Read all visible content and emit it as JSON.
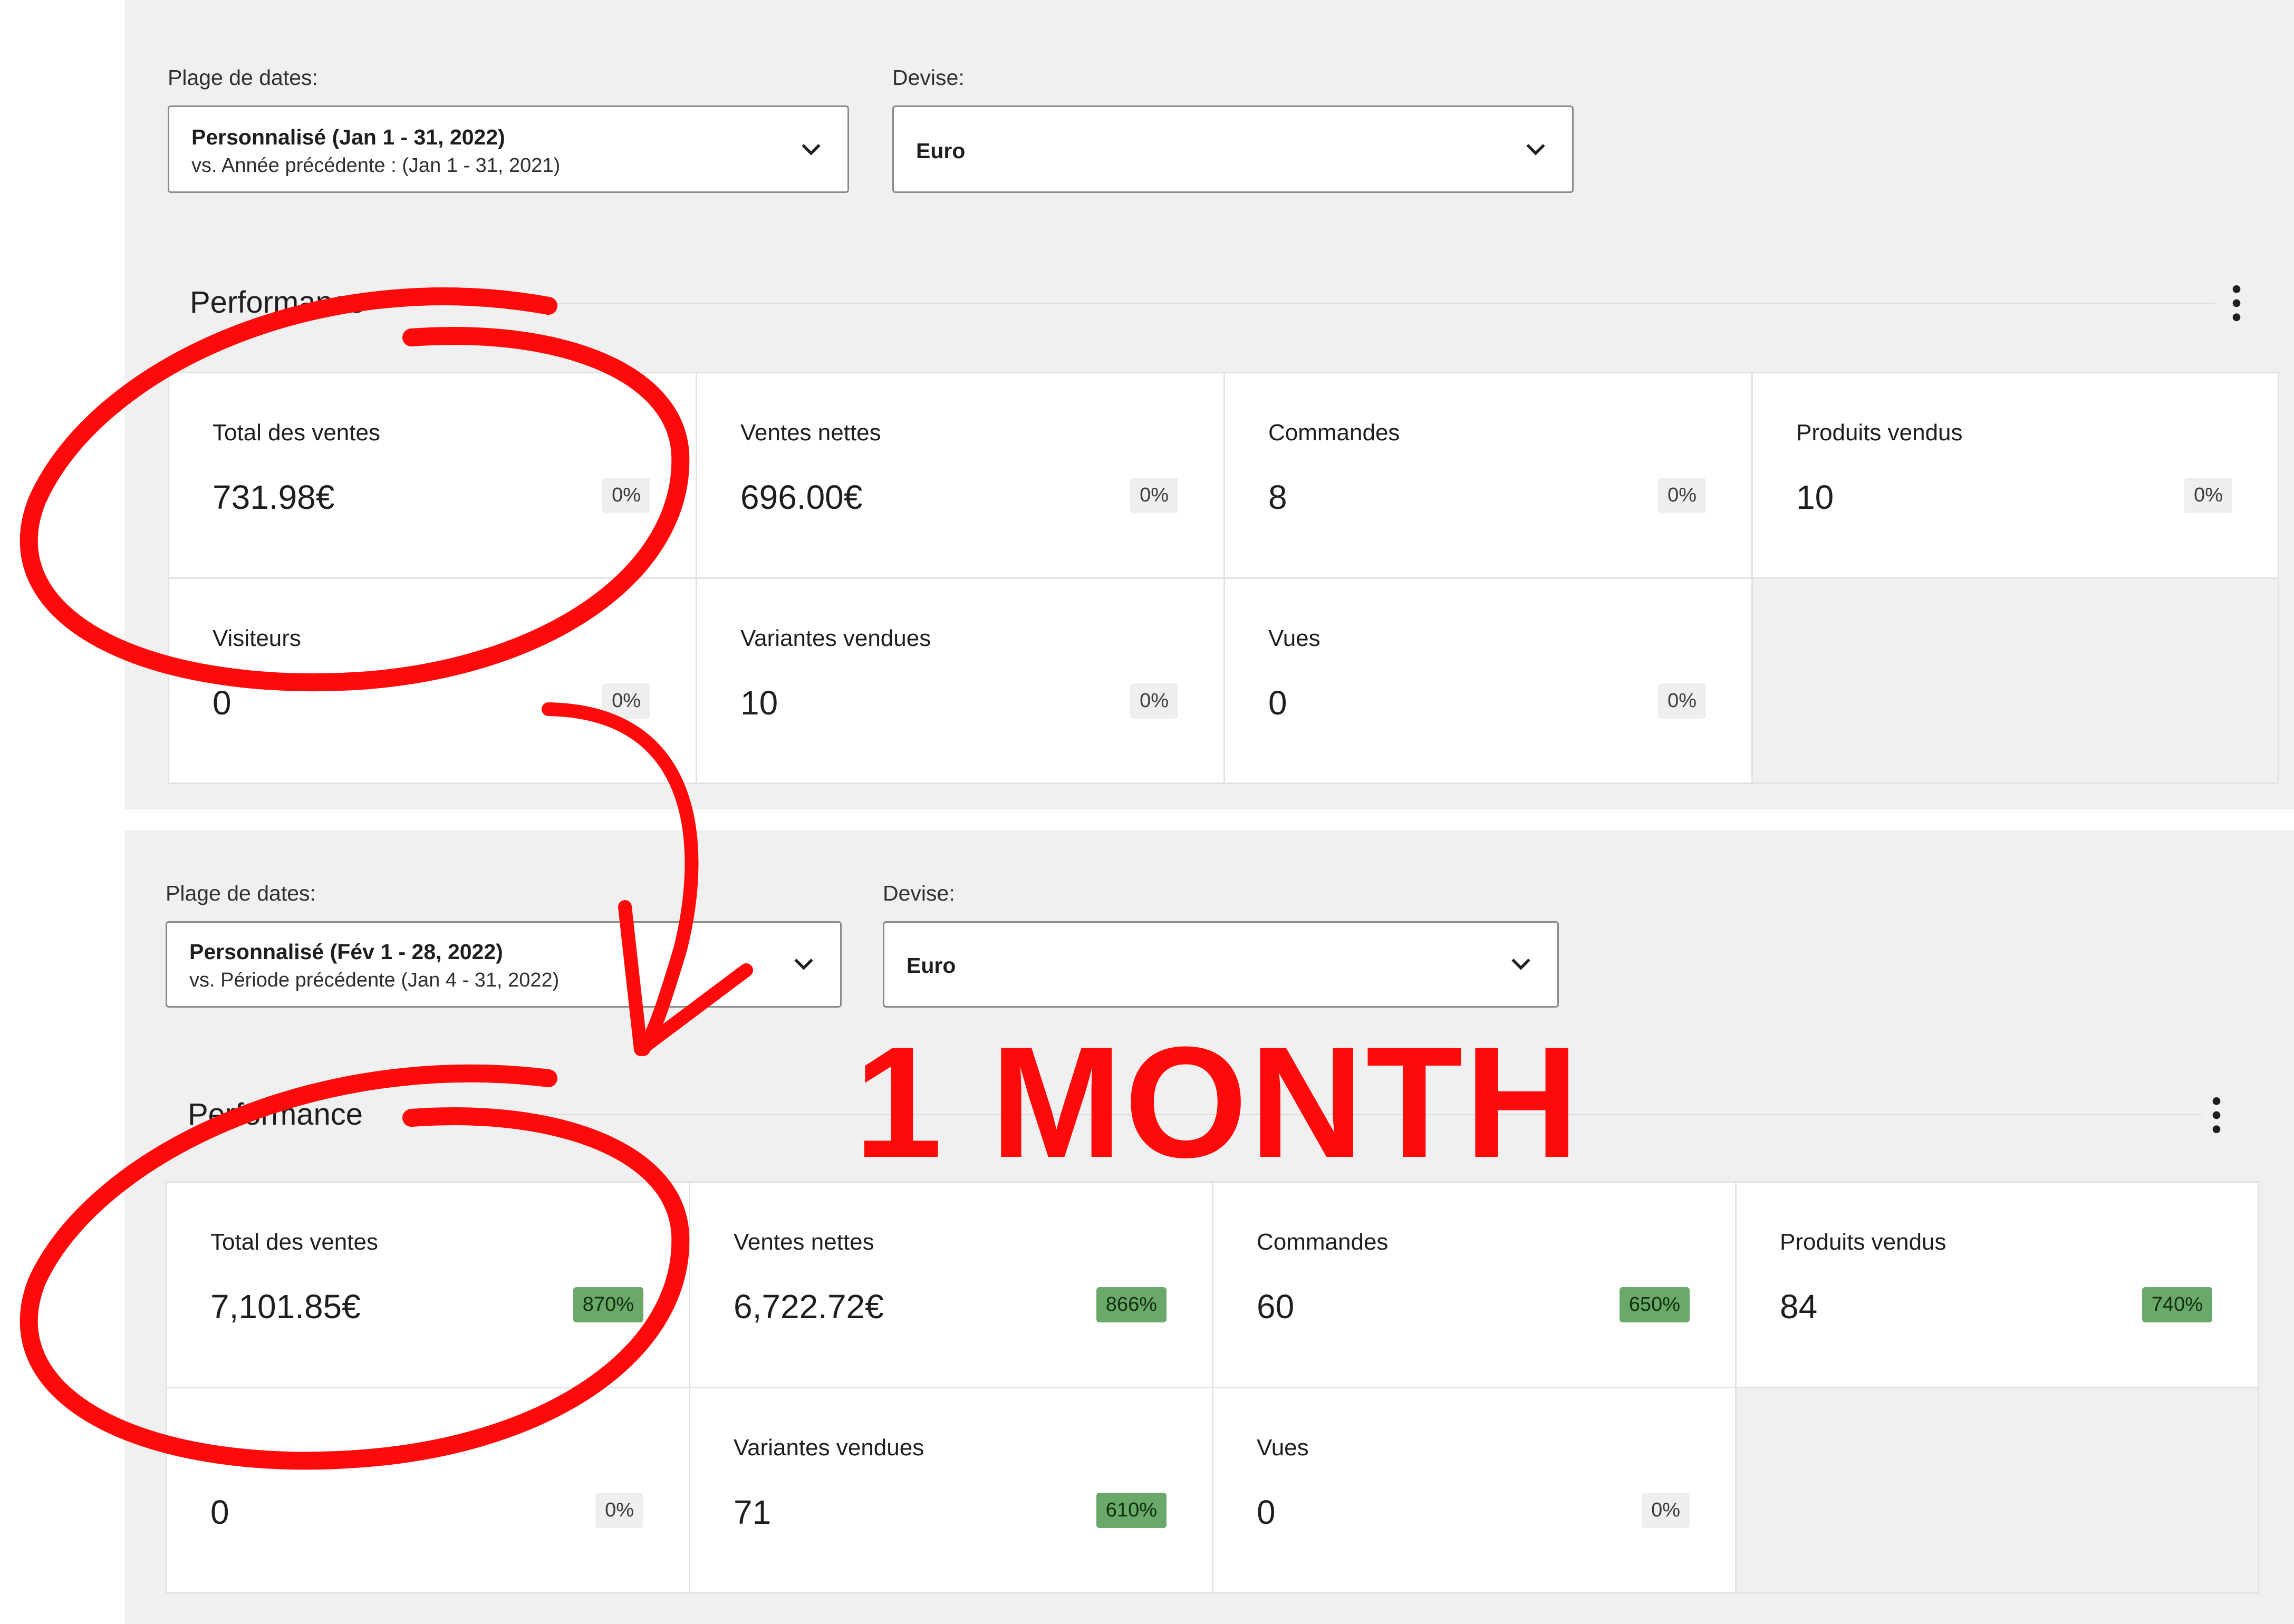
{
  "sections": [
    {
      "date_label": "Plage de dates:",
      "date_main": "Personnalisé (Jan 1 - 31, 2022)",
      "date_sub": "vs. Année précédente : (Jan 1 - 31, 2021)",
      "currency_label": "Devise:",
      "currency_value": "Euro",
      "performance_title": "Performance",
      "cards": [
        {
          "label": "Total des ventes",
          "value": "731.98€",
          "change": "0%"
        },
        {
          "label": "Ventes nettes",
          "value": "696.00€",
          "change": "0%"
        },
        {
          "label": "Commandes",
          "value": "8",
          "change": "0%"
        },
        {
          "label": "Produits vendus",
          "value": "10",
          "change": "0%"
        },
        {
          "label": "Visiteurs",
          "value": "0",
          "change": "0%"
        },
        {
          "label": "Variantes vendues",
          "value": "10",
          "change": "0%"
        },
        {
          "label": "Vues",
          "value": "0",
          "change": "0%"
        }
      ]
    },
    {
      "date_label": "Plage de dates:",
      "date_main": "Personnalisé (Fév 1 - 28, 2022)",
      "date_sub": "vs. Période précédente (Jan 4 - 31, 2022)",
      "currency_label": "Devise:",
      "currency_value": "Euro",
      "performance_title": "Performance",
      "cards": [
        {
          "label": "Total des ventes",
          "value": "7,101.85€",
          "change": "870%"
        },
        {
          "label": "Ventes nettes",
          "value": "6,722.72€",
          "change": "866%"
        },
        {
          "label": "Commandes",
          "value": "60",
          "change": "650%"
        },
        {
          "label": "Produits vendus",
          "value": "84",
          "change": "740%"
        },
        {
          "label": "",
          "value": "0",
          "change": "0%"
        },
        {
          "label": "Variantes vendues",
          "value": "71",
          "change": "610%"
        },
        {
          "label": "Vues",
          "value": "0",
          "change": "0%"
        }
      ]
    }
  ],
  "annotation": {
    "text": "1 MONTH",
    "color": "#ff0a0a"
  },
  "colors": {
    "positive_badge": "#6aa96a",
    "neutral_badge": "#efefef",
    "panel_bg": "#f0f0f0"
  }
}
